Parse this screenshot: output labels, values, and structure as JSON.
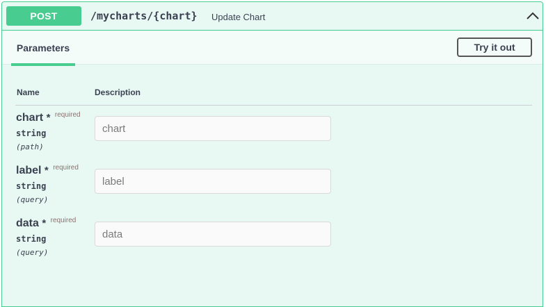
{
  "operation": {
    "method": "POST",
    "path": "/mycharts/{chart}",
    "summary": "Update Chart"
  },
  "tabs": {
    "parameters_label": "Parameters",
    "try_it_out_label": "Try it out"
  },
  "table": {
    "name_header": "Name",
    "description_header": "Description"
  },
  "params": [
    {
      "name": "chart",
      "star": "*",
      "required": "required",
      "type": "string",
      "in": "(path)",
      "placeholder": "chart"
    },
    {
      "name": "label",
      "star": "*",
      "required": "required",
      "type": "string",
      "in": "(query)",
      "placeholder": "label"
    },
    {
      "name": "data",
      "star": "*",
      "required": "required",
      "type": "string",
      "in": "(query)",
      "placeholder": "data"
    }
  ],
  "colors": {
    "accent": "#49cc90",
    "background": "#e8f9f3"
  }
}
